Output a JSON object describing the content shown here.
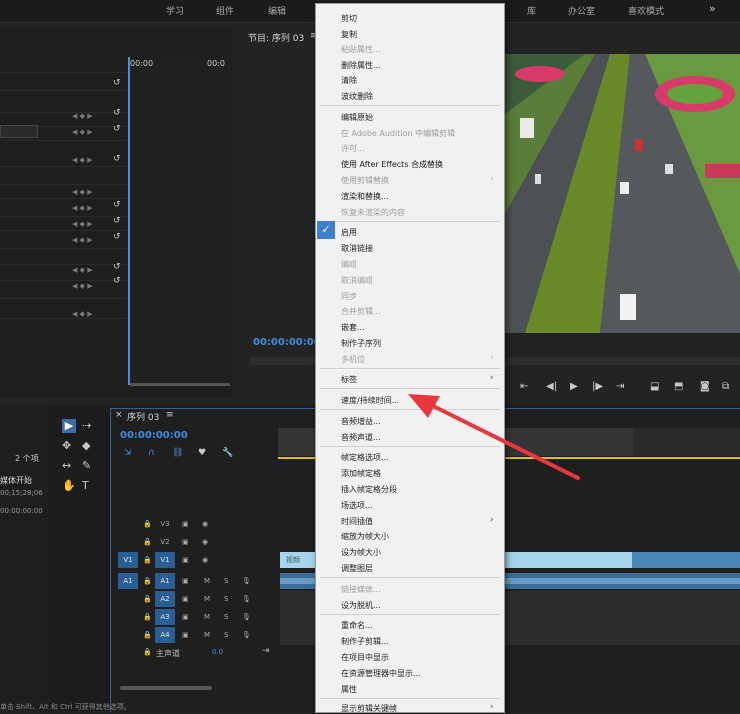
{
  "topbar": {
    "workspaces": [
      "学习",
      "组件",
      "编辑",
      "库",
      "办公室",
      "喜欢模式"
    ],
    "more": "»"
  },
  "effect_controls": {
    "tc_left": "00:00",
    "tc_right": "00:0"
  },
  "program_monitor": {
    "title": "节目: 序列 03",
    "menu_icon": "≡",
    "timecode": "00:00:00:00"
  },
  "project": {
    "item_count": "2 个项",
    "col_media_start": "媒体开始",
    "row1_time": "00;15;28;06",
    "row2_time": "00:00:00:00"
  },
  "timeline": {
    "tab_close": "×",
    "title": "序列 03",
    "menu_icon": "≡",
    "timecode": "00:00:00:00",
    "video_tracks": [
      {
        "label": "V3"
      },
      {
        "label": "V2"
      },
      {
        "label": "V1",
        "source": "V1"
      }
    ],
    "audio_tracks": [
      {
        "label": "A1",
        "source": "A1"
      },
      {
        "label": "A2"
      },
      {
        "label": "A3"
      },
      {
        "label": "A4"
      }
    ],
    "master_label": "主声道",
    "master_value": "0.0",
    "clip_label": "视频",
    "mute": "M",
    "solo": "S"
  },
  "status_bar": "单击 Shift、Alt 和 Ctrl 可获得其他选项。",
  "context_menu": {
    "items": [
      {
        "label": "剪切",
        "enabled": true
      },
      {
        "label": "复制",
        "enabled": true
      },
      {
        "label": "粘贴属性...",
        "enabled": false
      },
      {
        "label": "删除属性...",
        "enabled": true
      },
      {
        "label": "清除",
        "enabled": true
      },
      {
        "label": "波纹删除",
        "enabled": true
      },
      {
        "label": "编辑原始",
        "enabled": true
      },
      {
        "label": "在 Adobe Audition 中编辑剪辑",
        "enabled": false
      },
      {
        "label": "许可...",
        "enabled": false
      },
      {
        "label": "使用 After Effects 合成替换",
        "enabled": true
      },
      {
        "label": "使用剪辑替换",
        "enabled": false,
        "submenu": true
      },
      {
        "label": "渲染和替换...",
        "enabled": true
      },
      {
        "label": "恢复未渲染的内容",
        "enabled": false
      },
      {
        "label": "启用",
        "enabled": true,
        "checked": true
      },
      {
        "label": "取消链接",
        "enabled": true
      },
      {
        "label": "编组",
        "enabled": false
      },
      {
        "label": "取消编组",
        "enabled": false
      },
      {
        "label": "同步",
        "enabled": false
      },
      {
        "label": "合并剪辑...",
        "enabled": false
      },
      {
        "label": "嵌套...",
        "enabled": true
      },
      {
        "label": "制作子序列",
        "enabled": true
      },
      {
        "label": "多机位",
        "enabled": false,
        "submenu": true
      },
      {
        "label": "标签",
        "enabled": true,
        "submenu": true
      },
      {
        "label": "速度/持续时间...",
        "enabled": true
      },
      {
        "label": "音频增益...",
        "enabled": true
      },
      {
        "label": "音频声道...",
        "enabled": true
      },
      {
        "label": "帧定格选项...",
        "enabled": true
      },
      {
        "label": "添加帧定格",
        "enabled": true
      },
      {
        "label": "插入帧定格分段",
        "enabled": true
      },
      {
        "label": "场选项...",
        "enabled": true
      },
      {
        "label": "时间插值",
        "enabled": true,
        "submenu": true
      },
      {
        "label": "缩放为帧大小",
        "enabled": true
      },
      {
        "label": "设为帧大小",
        "enabled": true
      },
      {
        "label": "调整图层",
        "enabled": true
      },
      {
        "label": "链接媒体...",
        "enabled": false
      },
      {
        "label": "设为脱机...",
        "enabled": true
      },
      {
        "label": "重命名...",
        "enabled": true
      },
      {
        "label": "制作子剪辑...",
        "enabled": true
      },
      {
        "label": "在项目中显示",
        "enabled": true
      },
      {
        "label": "在资源管理器中显示...",
        "enabled": true
      },
      {
        "label": "属性",
        "enabled": true
      },
      {
        "label": "显示剪辑关键帧",
        "enabled": true,
        "submenu": true
      }
    ],
    "check_mark": "✓",
    "submenu_arrow": "›"
  },
  "colors": {
    "accent_blue": "#3d8ee0",
    "annotation_arrow": "#e8383d",
    "playhead_yellow": "#d6c400"
  },
  "icons": [
    "selection-tool-icon",
    "track-select-icon",
    "ripple-edit-icon",
    "razor-icon",
    "slip-icon",
    "pen-icon",
    "hand-icon",
    "type-icon",
    "lock-icon",
    "eye-icon",
    "mic-icon",
    "wrench-icon",
    "marker-icon",
    "snap-icon",
    "linked-icon",
    "play-icon",
    "step-back-icon",
    "step-forward-icon",
    "camera-icon"
  ]
}
